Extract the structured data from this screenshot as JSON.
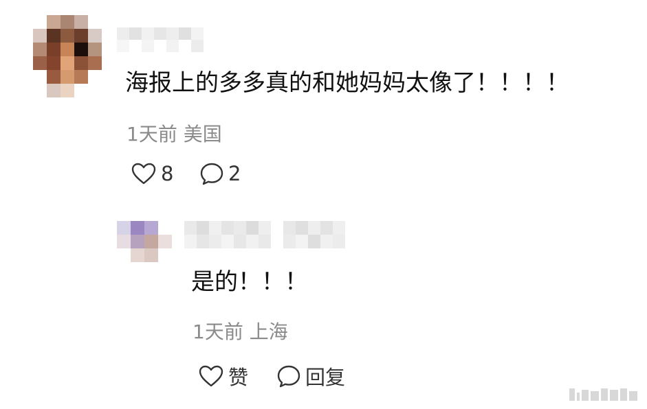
{
  "comment": {
    "text": "海报上的多多真的和她妈妈太像了！！！！",
    "time": "1天前",
    "location": "美国",
    "likes": "8",
    "replies": "2"
  },
  "reply": {
    "text": "是的！！！",
    "time": "1天前",
    "location": "上海",
    "like_label": "赞",
    "reply_label": "回复"
  },
  "icons": {
    "like": "heart-outline-icon",
    "comment": "speech-bubble-icon"
  },
  "colors": {
    "text": "#111111",
    "meta": "#8a8a8a",
    "icon": "#333333"
  }
}
